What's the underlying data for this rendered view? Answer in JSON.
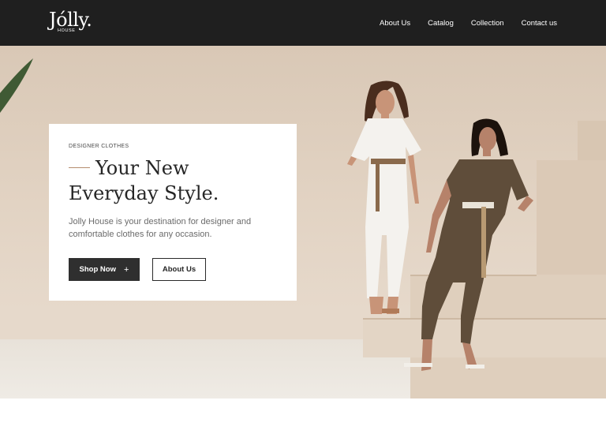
{
  "header": {
    "logo": {
      "name": "Jólly.",
      "sub": "HOUSE"
    },
    "nav": [
      {
        "label": "About Us"
      },
      {
        "label": "Catalog"
      },
      {
        "label": "Collection"
      },
      {
        "label": "Contact us"
      }
    ]
  },
  "hero": {
    "eyebrow": "DESIGNER CLOTHES",
    "headline_line1": "Your New",
    "headline_line2": "Everyday Style.",
    "description": "Jolly House is your destination for designer and comfortable clothes for any occasion.",
    "primary_button": {
      "label": "Shop Now",
      "icon": "plus-icon",
      "icon_glyph": "+"
    },
    "secondary_button": {
      "label": "About Us"
    }
  },
  "colors": {
    "header_bg": "#1f1f1f",
    "accent_dash": "#b58d6e",
    "primary_button_bg": "#2f2f2f",
    "wall": "#dccbb9"
  }
}
